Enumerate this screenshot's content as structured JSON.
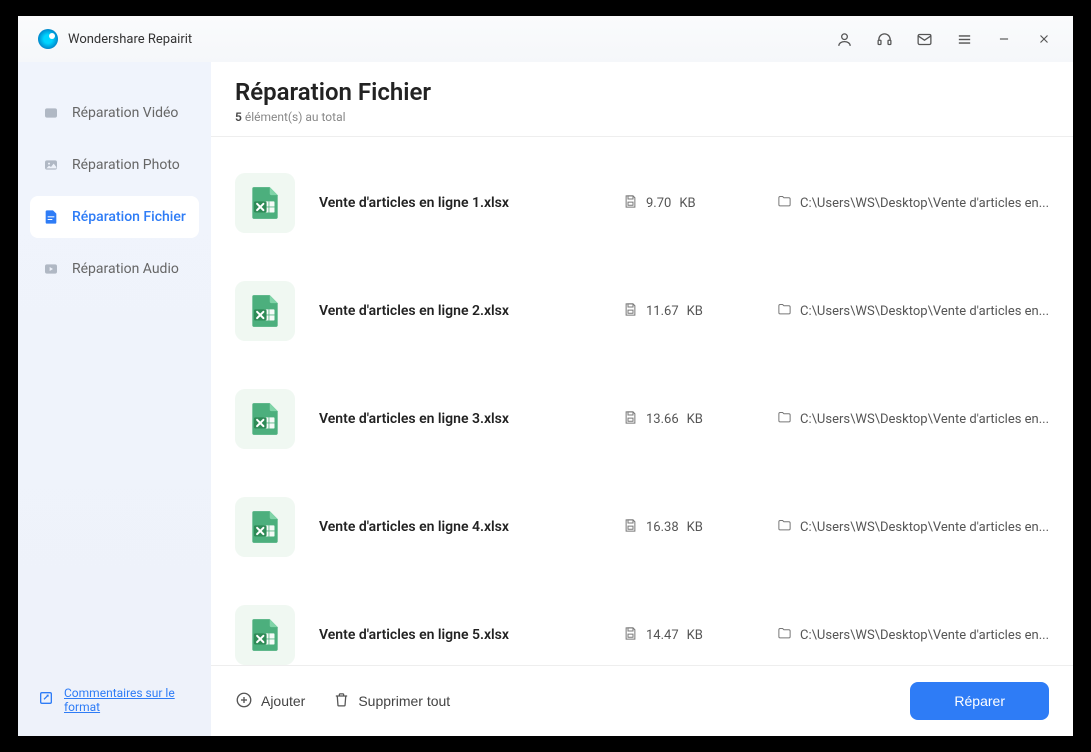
{
  "app": {
    "title": "Wondershare Repairit"
  },
  "sidebar": {
    "items": [
      {
        "label": "Réparation Vidéo"
      },
      {
        "label": "Réparation Photo"
      },
      {
        "label": "Réparation Fichier"
      },
      {
        "label": "Réparation Audio"
      }
    ],
    "footer_link": "Commentaires sur le format"
  },
  "header": {
    "title": "Réparation Fichier",
    "count": "5",
    "subtitle_suffix": "élément(s) au total"
  },
  "files": [
    {
      "name": "Vente d'articles en ligne 1.xlsx",
      "size_value": "9.70",
      "size_unit": "KB",
      "path": "C:\\Users\\WS\\Desktop\\Vente d'articles en..."
    },
    {
      "name": "Vente d'articles en ligne 2.xlsx",
      "size_value": "11.67",
      "size_unit": "KB",
      "path": "C:\\Users\\WS\\Desktop\\Vente d'articles en..."
    },
    {
      "name": "Vente d'articles en ligne 3.xlsx",
      "size_value": "13.66",
      "size_unit": "KB",
      "path": "C:\\Users\\WS\\Desktop\\Vente d'articles en..."
    },
    {
      "name": "Vente d'articles en ligne 4.xlsx",
      "size_value": "16.38",
      "size_unit": "KB",
      "path": "C:\\Users\\WS\\Desktop\\Vente d'articles en..."
    },
    {
      "name": "Vente d'articles en ligne 5.xlsx",
      "size_value": "14.47",
      "size_unit": "KB",
      "path": "C:\\Users\\WS\\Desktop\\Vente d'articles en..."
    }
  ],
  "footer": {
    "add_label": "Ajouter",
    "delete_label": "Supprimer tout",
    "repair_label": "Réparer"
  }
}
